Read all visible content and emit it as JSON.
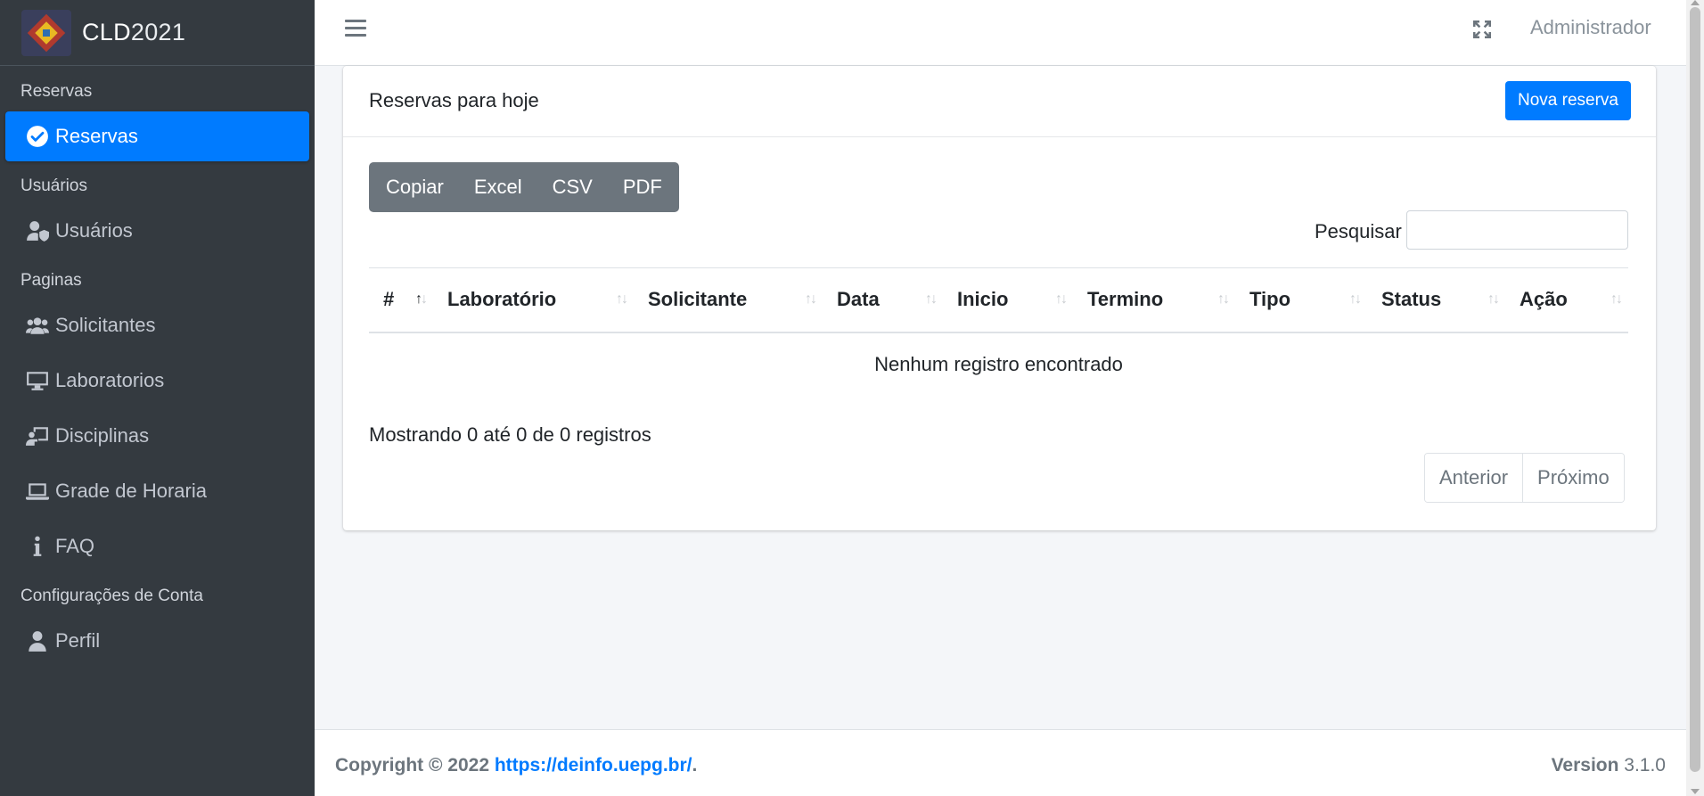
{
  "brand": {
    "name_bold": "CLD",
    "name_light": "2021"
  },
  "topbar": {
    "user": "Administrador"
  },
  "sidebar": {
    "sections": [
      {
        "header": "Reservas",
        "items": [
          {
            "label": "Reservas",
            "icon": "check-circle-icon",
            "active": true
          }
        ]
      },
      {
        "header": "Usuários",
        "items": [
          {
            "label": "Usuários",
            "icon": "user-shield-icon"
          }
        ]
      },
      {
        "header": "Paginas",
        "items": [
          {
            "label": "Solicitantes",
            "icon": "users-icon"
          },
          {
            "label": "Laboratorios",
            "icon": "desktop-icon"
          },
          {
            "label": "Disciplinas",
            "icon": "chalkboard-teacher-icon"
          },
          {
            "label": "Grade de Horaria",
            "icon": "laptop-icon"
          },
          {
            "label": "FAQ",
            "icon": "info-icon"
          }
        ]
      },
      {
        "header": "Configurações de Conta",
        "items": [
          {
            "label": "Perfil",
            "icon": "user-icon"
          }
        ]
      }
    ]
  },
  "card": {
    "title": "Reservas para hoje",
    "new_button": "Nova reserva",
    "export_buttons": [
      "Copiar",
      "Excel",
      "CSV",
      "PDF"
    ],
    "search_label": "Pesquisar",
    "search_value": "",
    "table": {
      "columns": [
        "#",
        "Laboratório",
        "Solicitante",
        "Data",
        "Inicio",
        "Termino",
        "Tipo",
        "Status",
        "Ação"
      ],
      "empty_message": "Nenhum registro encontrado"
    },
    "info": "Mostrando 0 até 0 de 0 registros",
    "pagination": {
      "prev": "Anterior",
      "next": "Próximo"
    }
  },
  "footer": {
    "copyright": "Copyright © 2022",
    "link": "https://deinfo.uepg.br/",
    "link_suffix": ".",
    "version_label": "Version",
    "version": "3.1.0"
  },
  "colors": {
    "primary": "#007bff",
    "sidebar_bg": "#343a40",
    "secondary": "#6c757d"
  }
}
